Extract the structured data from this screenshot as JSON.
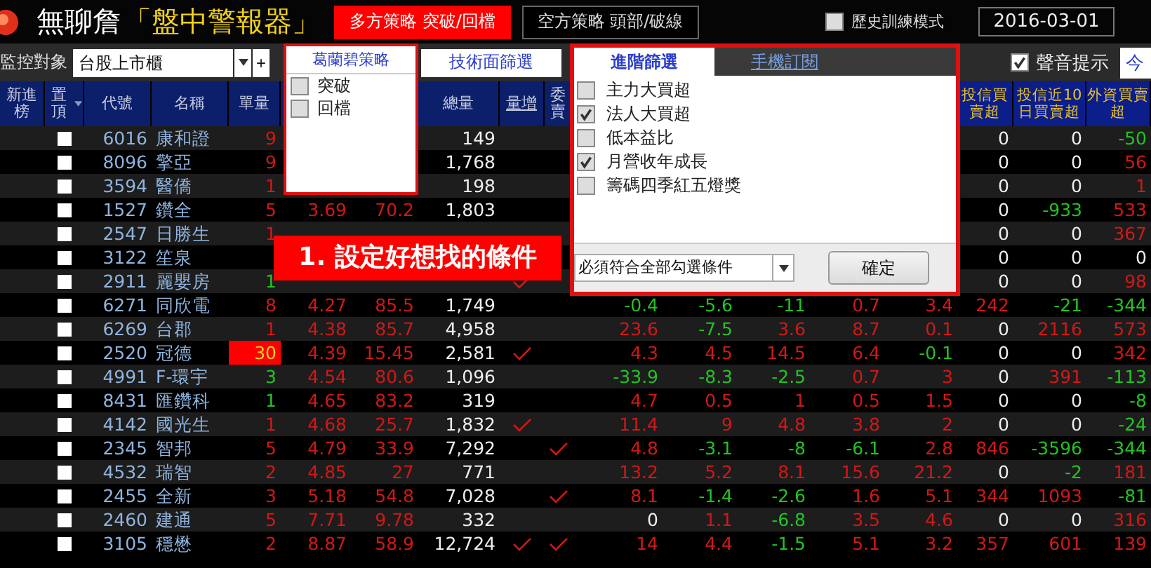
{
  "app": {
    "title": "無聊詹",
    "subtitle": "「盤中警報器」"
  },
  "tabs": [
    {
      "label": "多方策略  突破/回檔",
      "selected": true
    },
    {
      "label": "空方策略  頭部/破線",
      "selected": false
    }
  ],
  "history_mode": {
    "label": "歷史訓練模式",
    "checked": false
  },
  "date": "2016-03-01",
  "toolbar": {
    "monitor_label": "監控對象",
    "monitor_value": "台股上市櫃",
    "add": "+",
    "tech_button": "技術面篩選",
    "sound": {
      "label": "聲音提示",
      "checked": true
    },
    "today_button": "今"
  },
  "granville_popup": {
    "title": "葛蘭碧策略",
    "items": [
      {
        "label": "突破",
        "checked": false
      },
      {
        "label": "回檔",
        "checked": false
      }
    ]
  },
  "advanced_popup": {
    "tabs": [
      {
        "label": "進階篩選",
        "selected": true
      },
      {
        "label": "手機訂閱",
        "selected": false
      }
    ],
    "items": [
      {
        "label": "主力大買超",
        "checked": false
      },
      {
        "label": "法人大買超",
        "checked": true
      },
      {
        "label": "低本益比",
        "checked": false
      },
      {
        "label": "月營收年成長",
        "checked": true
      },
      {
        "label": "籌碼四季紅五燈獎",
        "checked": false
      }
    ],
    "match_select": "必須符合全部勾選條件",
    "confirm_button": "確定"
  },
  "banner": "1. 設定好想找的條件",
  "columns": {
    "new_entry": "新進榜",
    "pin": "置頂",
    "code": "代號",
    "name": "名稱",
    "qty": "單量",
    "total": "總量",
    "vol_up": "量增",
    "bid": "委賣",
    "trust": "投信買賣超",
    "trust_10d": "投信近10日買賣超",
    "foreign": "外資買賣超"
  },
  "rows": [
    {
      "code": "6016",
      "name": "康和證",
      "pinned": false,
      "vol_up": false,
      "bid": false,
      "cells": {
        "qty": {
          "v": "9",
          "color": "#d21818",
          "hot": false
        },
        "total": "149",
        "trust": {
          "v": "0",
          "color": "#eeeeee"
        },
        "trust_10d": {
          "v": "0",
          "color": "#eeeeee"
        },
        "foreign": {
          "v": "-50",
          "color": "#22c422"
        }
      }
    },
    {
      "code": "8096",
      "name": "擎亞",
      "pinned": false,
      "vol_up": false,
      "bid": false,
      "cells": {
        "qty": {
          "v": "9",
          "color": "#d21818",
          "hot": false
        },
        "total": "1,768",
        "trust": {
          "v": "0",
          "color": "#eeeeee"
        },
        "trust_10d": {
          "v": "0",
          "color": "#eeeeee"
        },
        "foreign": {
          "v": "56",
          "color": "#d21818"
        }
      }
    },
    {
      "code": "3594",
      "name": "醫僑",
      "pinned": false,
      "vol_up": false,
      "bid": false,
      "cells": {
        "qty": {
          "v": "1",
          "color": "#d21818",
          "hot": false
        },
        "total": "198",
        "trust": {
          "v": "0",
          "color": "#eeeeee"
        },
        "trust_10d": {
          "v": "0",
          "color": "#eeeeee"
        },
        "foreign": {
          "v": "1",
          "color": "#d21818"
        }
      }
    },
    {
      "code": "1527",
      "name": "鑽全",
      "pinned": false,
      "vol_up": false,
      "bid": false,
      "cells": {
        "qty": {
          "v": "5",
          "color": "#d21818",
          "hot": false
        },
        "price": "3.69",
        "pct": "70.2",
        "total": "1,803",
        "trust": {
          "v": "0",
          "color": "#eeeeee"
        },
        "trust_10d": {
          "v": "-933",
          "color": "#22c422"
        },
        "foreign": {
          "v": "533",
          "color": "#d21818"
        }
      }
    },
    {
      "code": "2547",
      "name": "日勝生",
      "pinned": false,
      "vol_up": false,
      "bid": false,
      "cells": {
        "qty": {
          "v": "1",
          "color": "#d21818",
          "hot": false
        },
        "trust": {
          "v": "0",
          "color": "#eeeeee"
        },
        "trust_10d": {
          "v": "0",
          "color": "#eeeeee"
        },
        "foreign": {
          "v": "367",
          "color": "#d21818"
        }
      }
    },
    {
      "code": "3122",
      "name": "笙泉",
      "pinned": false,
      "vol_up": false,
      "bid": false,
      "cells": {
        "trust": {
          "v": "0",
          "color": "#eeeeee"
        },
        "trust_10d": {
          "v": "0",
          "color": "#eeeeee"
        },
        "foreign": {
          "v": "0",
          "color": "#eeeeee"
        }
      }
    },
    {
      "code": "2911",
      "name": "麗嬰房",
      "pinned": false,
      "vol_up": true,
      "bid": false,
      "cells": {
        "qty": {
          "v": "1",
          "color": "#22c422",
          "hot": false
        },
        "trust": {
          "v": "0",
          "color": "#eeeeee"
        },
        "trust_10d": {
          "v": "0",
          "color": "#eeeeee"
        },
        "foreign": {
          "v": "98",
          "color": "#d21818"
        }
      }
    },
    {
      "code": "6271",
      "name": "同欣電",
      "pinned": false,
      "vol_up": false,
      "bid": false,
      "cells": {
        "qty": {
          "v": "8",
          "color": "#d21818",
          "hot": false
        },
        "price": "4.27",
        "pct": "85.5",
        "total": "1,749",
        "column_11": {
          "v": "-0.4",
          "color": "#22c422"
        },
        "column_12": {
          "v": "-5.6",
          "color": "#22c422"
        },
        "column_13": {
          "v": "-11",
          "color": "#22c422"
        },
        "column_14": {
          "v": "0.7",
          "color": "#d21818"
        },
        "column_15": {
          "v": "3.4",
          "color": "#d21818"
        },
        "trust": {
          "v": "242",
          "color": "#d21818"
        },
        "trust_10d": {
          "v": "-21",
          "color": "#22c422"
        },
        "foreign": {
          "v": "-344",
          "color": "#22c422"
        }
      }
    },
    {
      "code": "6269",
      "name": "台郡",
      "pinned": false,
      "vol_up": false,
      "bid": false,
      "cells": {
        "qty": {
          "v": "1",
          "color": "#d21818",
          "hot": false
        },
        "price": "4.38",
        "pct": "85.7",
        "total": "4,958",
        "column_11": {
          "v": "23.6",
          "color": "#d21818"
        },
        "column_12": {
          "v": "-7.5",
          "color": "#22c422"
        },
        "column_13": {
          "v": "3.6",
          "color": "#d21818"
        },
        "column_14": {
          "v": "8.7",
          "color": "#d21818"
        },
        "column_15": {
          "v": "0.1",
          "color": "#d21818"
        },
        "trust": {
          "v": "0",
          "color": "#eeeeee"
        },
        "trust_10d": {
          "v": "2116",
          "color": "#d21818"
        },
        "foreign": {
          "v": "573",
          "color": "#d21818"
        }
      }
    },
    {
      "code": "2520",
      "name": "冠德",
      "pinned": false,
      "vol_up": true,
      "bid": false,
      "cells": {
        "qty": {
          "v": "30",
          "color": "#f5d21a",
          "hot": true
        },
        "price": "4.39",
        "pct": "15.45",
        "total": "2,581",
        "column_11": {
          "v": "4.3",
          "color": "#d21818"
        },
        "column_12": {
          "v": "4.5",
          "color": "#d21818"
        },
        "column_13": {
          "v": "14.5",
          "color": "#d21818"
        },
        "column_14": {
          "v": "6.4",
          "color": "#d21818"
        },
        "column_15": {
          "v": "-0.1",
          "color": "#22c422"
        },
        "trust": {
          "v": "0",
          "color": "#eeeeee"
        },
        "trust_10d": {
          "v": "0",
          "color": "#eeeeee"
        },
        "foreign": {
          "v": "342",
          "color": "#d21818"
        }
      }
    },
    {
      "code": "4991",
      "name": "F-環宇",
      "pinned": false,
      "vol_up": false,
      "bid": false,
      "cells": {
        "qty": {
          "v": "3",
          "color": "#22c422",
          "hot": false
        },
        "price": "4.54",
        "pct": "80.6",
        "total": "1,096",
        "column_11": {
          "v": "-33.9",
          "color": "#22c422"
        },
        "column_12": {
          "v": "-8.3",
          "color": "#22c422"
        },
        "column_13": {
          "v": "-2.5",
          "color": "#22c422"
        },
        "column_14": {
          "v": "0.7",
          "color": "#d21818"
        },
        "column_15": {
          "v": "3",
          "color": "#d21818"
        },
        "trust": {
          "v": "0",
          "color": "#eeeeee"
        },
        "trust_10d": {
          "v": "391",
          "color": "#d21818"
        },
        "foreign": {
          "v": "-113",
          "color": "#22c422"
        }
      }
    },
    {
      "code": "8431",
      "name": "匯鑽科",
      "pinned": false,
      "vol_up": false,
      "bid": false,
      "cells": {
        "qty": {
          "v": "1",
          "color": "#22c422",
          "hot": false
        },
        "price": "4.65",
        "pct": "83.2",
        "total": "319",
        "column_11": {
          "v": "4.7",
          "color": "#d21818"
        },
        "column_12": {
          "v": "0.5",
          "color": "#d21818"
        },
        "column_13": {
          "v": "1",
          "color": "#d21818"
        },
        "column_14": {
          "v": "0.5",
          "color": "#d21818"
        },
        "column_15": {
          "v": "1.5",
          "color": "#d21818"
        },
        "trust": {
          "v": "0",
          "color": "#eeeeee"
        },
        "trust_10d": {
          "v": "0",
          "color": "#eeeeee"
        },
        "foreign": {
          "v": "-8",
          "color": "#22c422"
        }
      }
    },
    {
      "code": "4142",
      "name": "國光生",
      "pinned": false,
      "vol_up": true,
      "bid": false,
      "cells": {
        "qty": {
          "v": "1",
          "color": "#d21818",
          "hot": false
        },
        "price": "4.68",
        "pct": "25.7",
        "total": "1,832",
        "column_11": {
          "v": "11.4",
          "color": "#d21818"
        },
        "column_12": {
          "v": "9",
          "color": "#d21818"
        },
        "column_13": {
          "v": "4.8",
          "color": "#d21818"
        },
        "column_14": {
          "v": "3.8",
          "color": "#d21818"
        },
        "column_15": {
          "v": "2",
          "color": "#d21818"
        },
        "trust": {
          "v": "0",
          "color": "#eeeeee"
        },
        "trust_10d": {
          "v": "0",
          "color": "#eeeeee"
        },
        "foreign": {
          "v": "-24",
          "color": "#22c422"
        }
      }
    },
    {
      "code": "2345",
      "name": "智邦",
      "pinned": false,
      "vol_up": false,
      "bid": true,
      "cells": {
        "qty": {
          "v": "5",
          "color": "#d21818",
          "hot": false
        },
        "price": "4.79",
        "pct": "33.9",
        "total": "7,292",
        "column_11": {
          "v": "4.8",
          "color": "#d21818"
        },
        "column_12": {
          "v": "-3.1",
          "color": "#22c422"
        },
        "column_13": {
          "v": "-8",
          "color": "#22c422"
        },
        "column_14": {
          "v": "-6.1",
          "color": "#22c422"
        },
        "column_15": {
          "v": "2.8",
          "color": "#d21818"
        },
        "trust": {
          "v": "846",
          "color": "#d21818"
        },
        "trust_10d": {
          "v": "-3596",
          "color": "#22c422"
        },
        "foreign": {
          "v": "-344",
          "color": "#22c422"
        }
      }
    },
    {
      "code": "4532",
      "name": "瑞智",
      "pinned": false,
      "vol_up": false,
      "bid": false,
      "cells": {
        "qty": {
          "v": "2",
          "color": "#d21818",
          "hot": false
        },
        "price": "4.85",
        "pct": "27",
        "total": "771",
        "column_11": {
          "v": "13.2",
          "color": "#d21818"
        },
        "column_12": {
          "v": "5.2",
          "color": "#d21818"
        },
        "column_13": {
          "v": "8.1",
          "color": "#d21818"
        },
        "column_14": {
          "v": "15.6",
          "color": "#d21818"
        },
        "column_15": {
          "v": "21.2",
          "color": "#d21818"
        },
        "trust": {
          "v": "0",
          "color": "#eeeeee"
        },
        "trust_10d": {
          "v": "-2",
          "color": "#22c422"
        },
        "foreign": {
          "v": "181",
          "color": "#d21818"
        }
      }
    },
    {
      "code": "2455",
      "name": "全新",
      "pinned": false,
      "vol_up": false,
      "bid": true,
      "cells": {
        "qty": {
          "v": "3",
          "color": "#d21818",
          "hot": false
        },
        "price": "5.18",
        "pct": "54.8",
        "total": "7,028",
        "column_11": {
          "v": "8.1",
          "color": "#d21818"
        },
        "column_12": {
          "v": "-1.4",
          "color": "#22c422"
        },
        "column_13": {
          "v": "-2.6",
          "color": "#22c422"
        },
        "column_14": {
          "v": "1.6",
          "color": "#d21818"
        },
        "column_15": {
          "v": "5.1",
          "color": "#d21818"
        },
        "trust": {
          "v": "344",
          "color": "#d21818"
        },
        "trust_10d": {
          "v": "1093",
          "color": "#d21818"
        },
        "foreign": {
          "v": "-81",
          "color": "#22c422"
        }
      }
    },
    {
      "code": "2460",
      "name": "建通",
      "pinned": false,
      "vol_up": false,
      "bid": false,
      "cells": {
        "qty": {
          "v": "5",
          "color": "#d21818",
          "hot": false
        },
        "price": "7.71",
        "pct": "9.78",
        "total": "332",
        "column_11": {
          "v": "0",
          "color": "#eeeeee"
        },
        "column_12": {
          "v": "1.1",
          "color": "#d21818"
        },
        "column_13": {
          "v": "-6.8",
          "color": "#22c422"
        },
        "column_14": {
          "v": "3.5",
          "color": "#d21818"
        },
        "column_15": {
          "v": "4.6",
          "color": "#d21818"
        },
        "trust": {
          "v": "0",
          "color": "#eeeeee"
        },
        "trust_10d": {
          "v": "0",
          "color": "#eeeeee"
        },
        "foreign": {
          "v": "316",
          "color": "#d21818"
        }
      }
    },
    {
      "code": "3105",
      "name": "穩懋",
      "pinned": false,
      "vol_up": true,
      "bid": true,
      "cells": {
        "qty": {
          "v": "2",
          "color": "#d21818",
          "hot": false
        },
        "price": "8.87",
        "pct": "58.9",
        "total": "12,724",
        "column_11": {
          "v": "14",
          "color": "#d21818"
        },
        "column_12": {
          "v": "4.4",
          "color": "#d21818"
        },
        "column_13": {
          "v": "-1.5",
          "color": "#22c422"
        },
        "column_14": {
          "v": "5.1",
          "color": "#d21818"
        },
        "column_15": {
          "v": "3.2",
          "color": "#d21818"
        },
        "trust": {
          "v": "357",
          "color": "#d21818"
        },
        "trust_10d": {
          "v": "601",
          "color": "#d21818"
        },
        "foreign": {
          "v": "139",
          "color": "#d21818"
        }
      }
    }
  ]
}
